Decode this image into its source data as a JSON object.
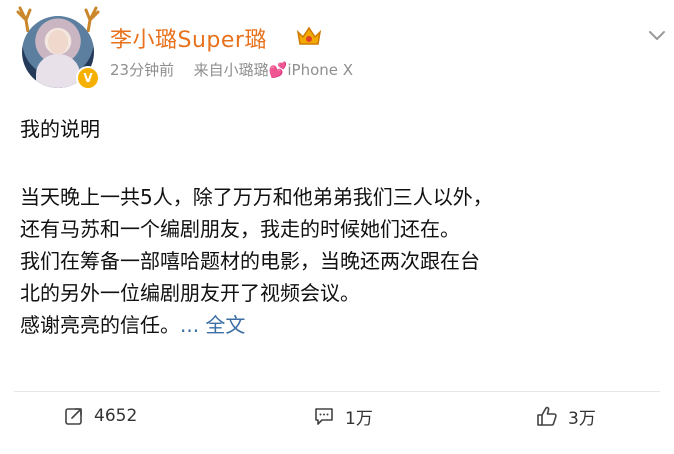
{
  "post": {
    "author": "李小璐Super璐",
    "meta": {
      "time": "23分钟前",
      "from_prefix": "来自",
      "source": "小璐璐",
      "device": "iPhone X"
    },
    "lines": [
      "我的说明",
      "当天晚上一共5人，除了万万和他弟弟我们三人以外，",
      "还有马苏和一个编剧朋友，我走的时候她们还在。",
      "我们在筹备一部嘻哈题材的电影，当晚还两次跟在台",
      "北的另外一位编剧朋友开了视频会议。",
      "感谢亮亮的信任。"
    ],
    "more_label": "... 全文"
  },
  "actions": {
    "share_count": "4652",
    "comment_count": "1万",
    "like_count": "3万"
  },
  "colors": {
    "author": "#e8721c",
    "link": "#3b6ea5",
    "meta": "#8f8f8f",
    "verified_badge": "#f6b100"
  },
  "icons": [
    "antler-icon",
    "verified-badge-icon",
    "crown-badge-icon",
    "chevron-down-icon",
    "heart-icon",
    "share-icon",
    "comment-icon",
    "like-icon"
  ]
}
